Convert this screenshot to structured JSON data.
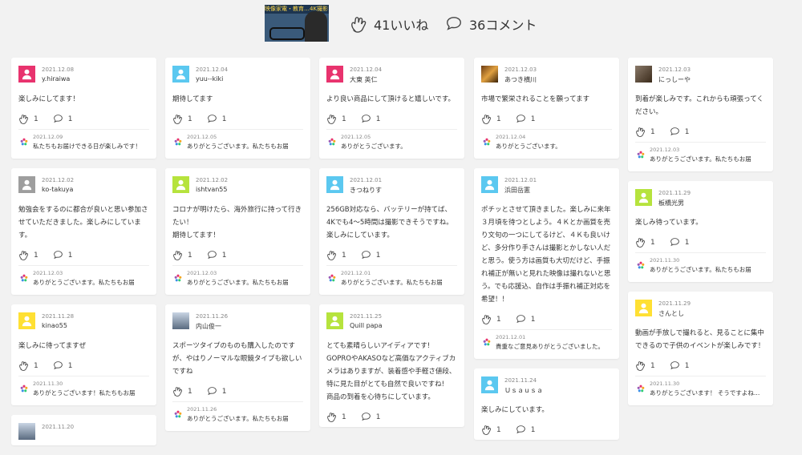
{
  "header": {
    "thumbnail_text": "映像家電・教育…4K撮影・AI自動",
    "likes": "41いいね",
    "comments": "36コメント"
  },
  "columns": [
    [
      {
        "avatar": "#e8336e",
        "date": "2021.12.08",
        "name": "y.hiraiwa",
        "text": "楽しみにしてます！",
        "likes": "1",
        "comments": "1",
        "reply_date": "2021.12.09",
        "reply": "私たちもお届けできる日が楽しみです！"
      },
      {
        "avatar": "#9e9e9e",
        "date": "2021.12.02",
        "name": "ko-takuya",
        "text": "勉強会をするのに都合が良いと思い参加させていただきました。楽しみにしています。",
        "likes": "1",
        "comments": "1",
        "reply_date": "2021.12.03",
        "reply": "ありがとうございます。私たちもお届"
      },
      {
        "avatar": "#ffe033",
        "date": "2021.11.28",
        "name": "kinao55",
        "text": "楽しみに待ってますぜ",
        "likes": "1",
        "comments": "1",
        "reply_date": "2021.11.30",
        "reply": "ありがとうございます！私たちもお届"
      },
      {
        "avatar": "photo",
        "date": "2021.11.20",
        "name": "",
        "text": "",
        "likes": "",
        "comments": "",
        "reply_date": "",
        "reply": ""
      }
    ],
    [
      {
        "avatar": "#5bc8f0",
        "date": "2021.12.04",
        "name": "yuu--kiki",
        "text": "期待してます",
        "likes": "1",
        "comments": "1",
        "reply_date": "2021.12.05",
        "reply": "ありがとうございます。私たちもお届"
      },
      {
        "avatar": "#b6e33d",
        "date": "2021.12.02",
        "name": "ishtvan55",
        "text": "コロナが明けたら、海外旅行に持って行きたい！\n期待してます！",
        "likes": "1",
        "comments": "1",
        "reply_date": "2021.12.03",
        "reply": "ありがとうございます。私たちもお届"
      },
      {
        "avatar": "photo",
        "date": "2021.11.26",
        "name": "内山俊一",
        "text": "スポーツタイプのものも購入したのですが、やはりノーマルな眼鏡タイプも欲しいですね",
        "likes": "1",
        "comments": "1",
        "reply_date": "2021.11.26",
        "reply": "ありがとうございます。私たちもお届"
      }
    ],
    [
      {
        "avatar": "#e8336e",
        "date": "2021.12.04",
        "name": "大東 英仁",
        "text": "より良い商品にして頂けると嬉しいです。",
        "likes": "1",
        "comments": "1",
        "reply_date": "2021.12.05",
        "reply": "ありがとうございます。"
      },
      {
        "avatar": "#5bc8f0",
        "date": "2021.12.01",
        "name": "きつねりす",
        "text": "256GB対応なら、バッテリーが持てば、4Kでも4〜5時間は撮影できそうですね。楽しみにしています。",
        "likes": "1",
        "comments": "1",
        "reply_date": "2021.12.01",
        "reply": "ありがとうございます。私たちもお届"
      },
      {
        "avatar": "#b6e33d",
        "date": "2021.11.25",
        "name": "Quill papa",
        "text": "とても素晴らしいアイディアです!\nGOPROやAKASOなど高価なアクティブカメラはありますが、装着感や手軽さ値段、特に見た目がとても自然で良いですね!\n商品の到着を心待ちにしています。",
        "likes": "1",
        "comments": "1",
        "reply_date": "",
        "reply": ""
      }
    ],
    [
      {
        "avatar": "photo2",
        "date": "2021.12.03",
        "name": "あつき横川",
        "text": "市場で繁栄されることを願ってます",
        "likes": "1",
        "comments": "1",
        "reply_date": "2021.12.04",
        "reply": "ありがとうございます。"
      },
      {
        "avatar": "#5bc8f0",
        "date": "2021.12.01",
        "name": "浜田岳憲",
        "text": "ポチッとさせて頂きました。楽しみに来年３月頃を待つとしよう。４Ｋとか画質を売り文句の一つにしてるけど、４Ｋも良いけど、多分作り手さんは撮影とかしない人だと思う。使う方は画質も大切だけど、手振れ補正が無いと見れた映像は撮れないと思う。でも応援込、自作は手振れ補正対応を希望！！",
        "likes": "1",
        "comments": "1",
        "reply_date": "2021.12.01",
        "reply": "貴重なご意見ありがとうございました。"
      },
      {
        "avatar": "#5bc8f0",
        "date": "2021.11.24",
        "name": "Ｕｓａｕｓａ",
        "text": "楽しみにしています。",
        "likes": "1",
        "comments": "1",
        "reply_date": "",
        "reply": ""
      }
    ],
    [
      {
        "avatar": "photo3",
        "date": "2021.12.03",
        "name": "にっしーや",
        "text": "到着が楽しみです。これからも頑張ってください。",
        "likes": "1",
        "comments": "1",
        "reply_date": "2021.12.03",
        "reply": "ありがとうございます。私たちもお届"
      },
      {
        "avatar": "#b6e33d",
        "date": "2021.11.29",
        "name": "板橋光男",
        "text": "楽しみ待っています。",
        "likes": "1",
        "comments": "1",
        "reply_date": "2021.11.30",
        "reply": "ありがとうございます。私たちもお届"
      },
      {
        "avatar": "#ffe033",
        "date": "2021.11.29",
        "name": "さんとし",
        "text": "動画が手放しで撮れると、見ることに集中できるので子供のイベントが楽しみです！",
        "likes": "1",
        "comments": "1",
        "reply_date": "2021.11.30",
        "reply": "ありがとうございます！ そうですよね…"
      }
    ]
  ]
}
